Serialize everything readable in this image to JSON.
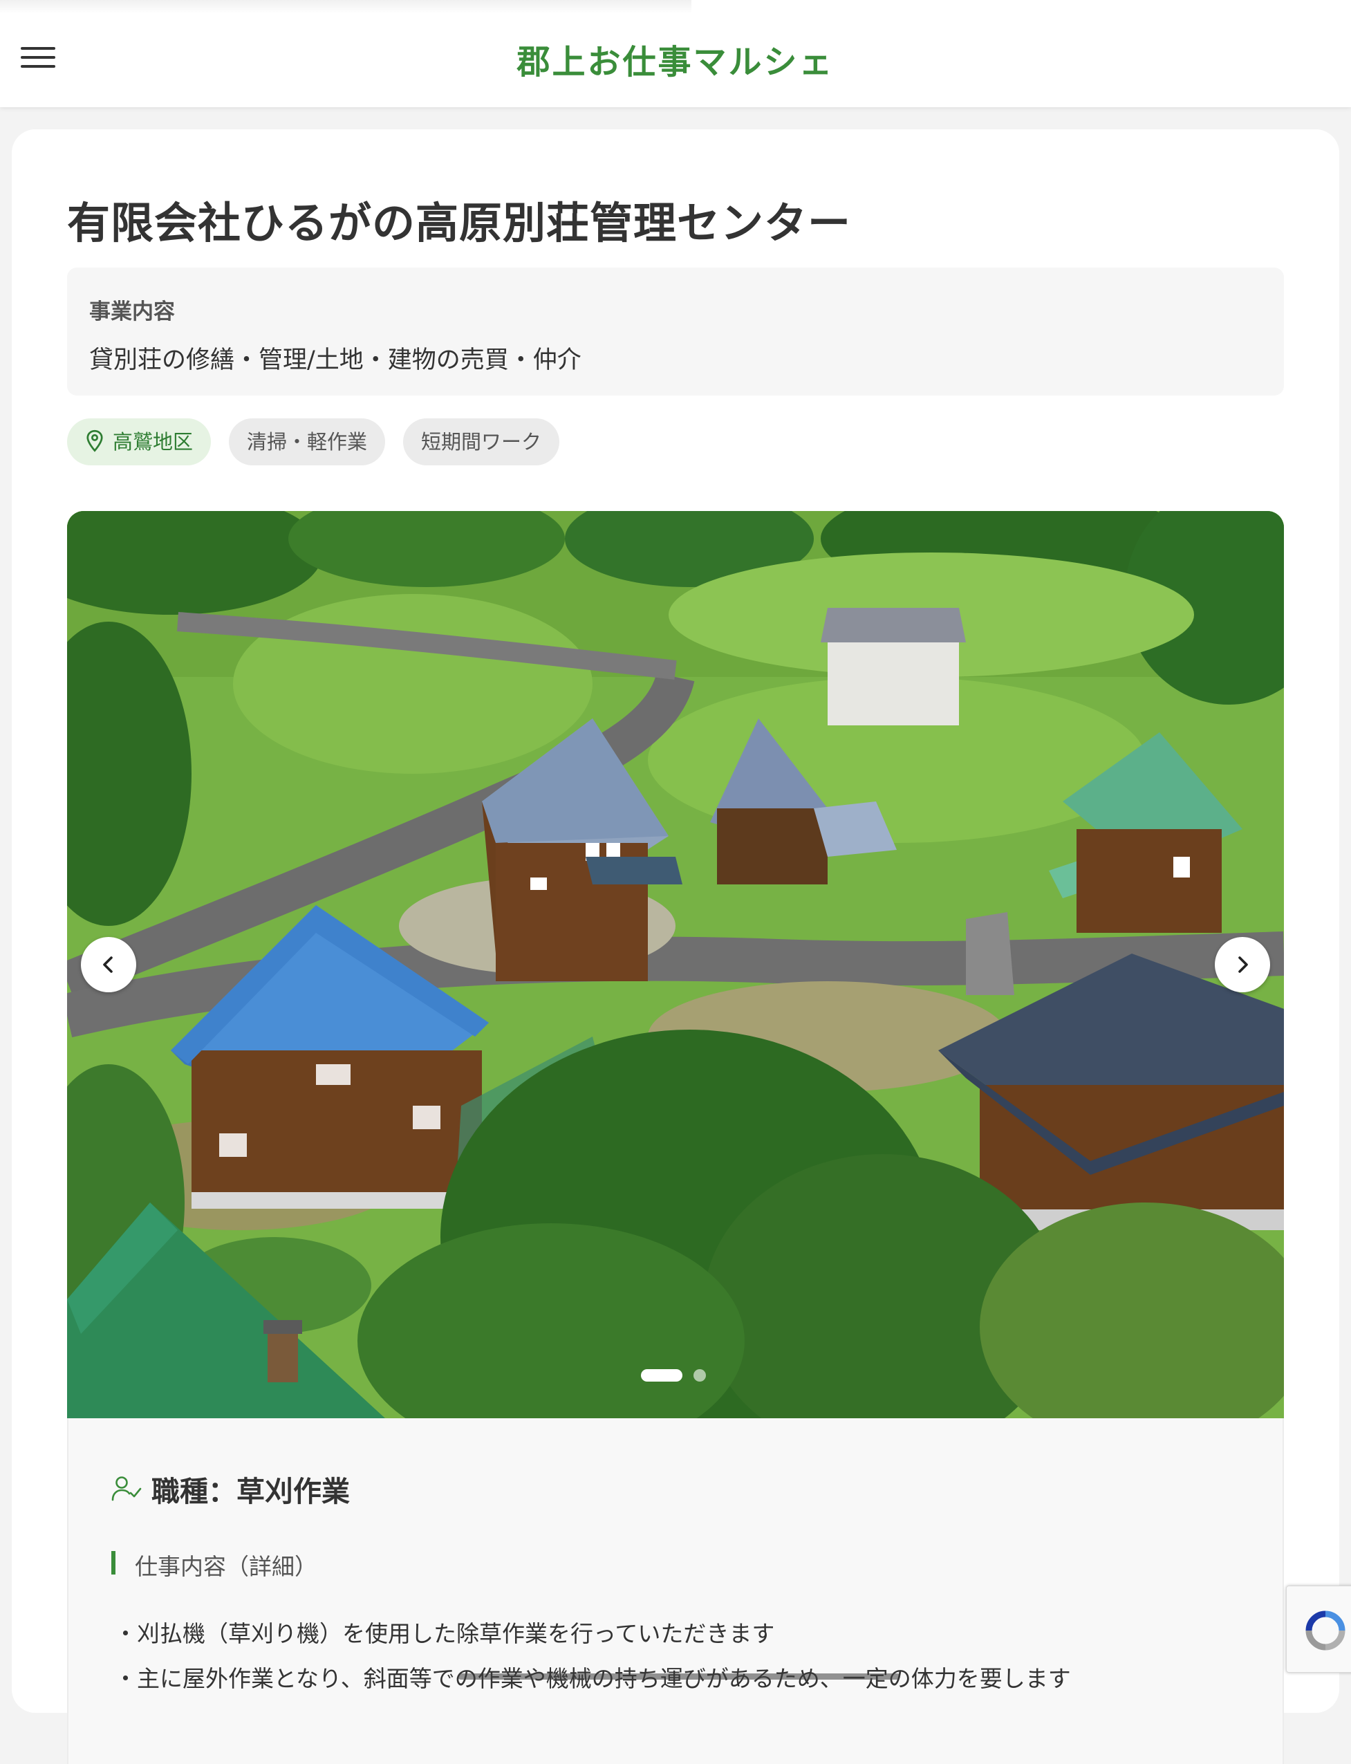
{
  "header": {
    "site_title": "郡上お仕事マルシェ",
    "menu_icon": "hamburger-menu-icon"
  },
  "company": {
    "name": "有限会社ひるがの高原別荘管理センター",
    "business_label": "事業内容",
    "business_text": "貸別荘の修繕・管理/土地・建物の売買・仲介"
  },
  "tags": {
    "location": "高鷲地区",
    "category": "清掃・軽作業",
    "duration": "短期間ワーク"
  },
  "carousel": {
    "slide_count": 2,
    "active_slide": 1,
    "image_icon": "aerial-photo-log-cabins"
  },
  "job": {
    "title": "職種：草刈作業",
    "detail_label": "仕事内容（詳細）",
    "lines": [
      "・刈払機（草刈り機）を使用した除草作業を行っていただきます",
      "・主に屋外作業となり、斜面等での作業や機械の持ち運びがあるため、一定の体力を要します"
    ]
  },
  "colors": {
    "accent": "#3a8d3a",
    "tag_location_bg": "#e6f3e3",
    "tag_gray_bg": "#ebebeb"
  }
}
